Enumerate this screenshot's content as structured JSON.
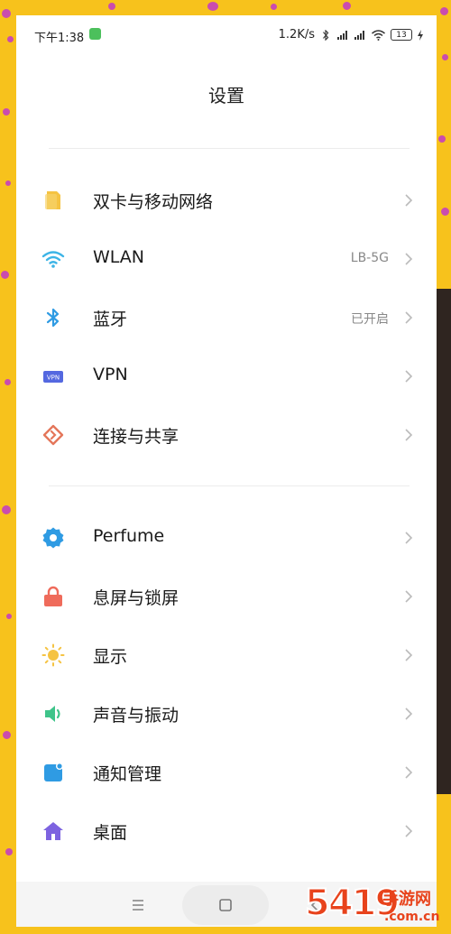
{
  "status_bar": {
    "time": "下午1:38",
    "speed": "1.2K/s",
    "battery": "13",
    "icons": [
      "wechat-icon",
      "bluetooth-icon",
      "hd-signal-icon",
      "hd-signal-icon",
      "wifi-icon",
      "battery-icon",
      "charging-icon"
    ]
  },
  "header": {
    "title": "设置"
  },
  "groups": [
    {
      "items": [
        {
          "label": "双卡与移动网络",
          "value": "",
          "icon": "sim-card-icon",
          "color": "#f5c342"
        },
        {
          "label": "WLAN",
          "value": "LB-5G",
          "icon": "wifi-icon",
          "color": "#3cb4e6"
        },
        {
          "label": "蓝牙",
          "value": "已开启",
          "icon": "bluetooth-icon",
          "color": "#2f9be3"
        },
        {
          "label": "VPN",
          "value": "",
          "icon": "vpn-icon",
          "color": "#5468e0"
        },
        {
          "label": "连接与共享",
          "value": "",
          "icon": "connection-sharing-icon",
          "color": "#e4765a"
        }
      ]
    },
    {
      "items": [
        {
          "label": "Perfume",
          "value": "",
          "icon": "gear-icon",
          "color": "#2f9be3"
        },
        {
          "label": "息屏与锁屏",
          "value": "",
          "icon": "lock-icon",
          "color": "#ef6b5b"
        },
        {
          "label": "显示",
          "value": "",
          "icon": "sun-icon",
          "color": "#f5c342"
        },
        {
          "label": "声音与振动",
          "value": "",
          "icon": "speaker-icon",
          "color": "#3fc48a"
        },
        {
          "label": "通知管理",
          "value": "",
          "icon": "notification-icon",
          "color": "#2f9be3"
        },
        {
          "label": "桌面",
          "value": "",
          "icon": "home-icon",
          "color": "#7d63e0"
        }
      ]
    }
  ],
  "nav": {
    "icons": [
      "menu-icon",
      "home-square-icon",
      "back-icon"
    ]
  },
  "watermark": {
    "number": "5419",
    "text": "手游网",
    "domain": ".com.cn"
  }
}
